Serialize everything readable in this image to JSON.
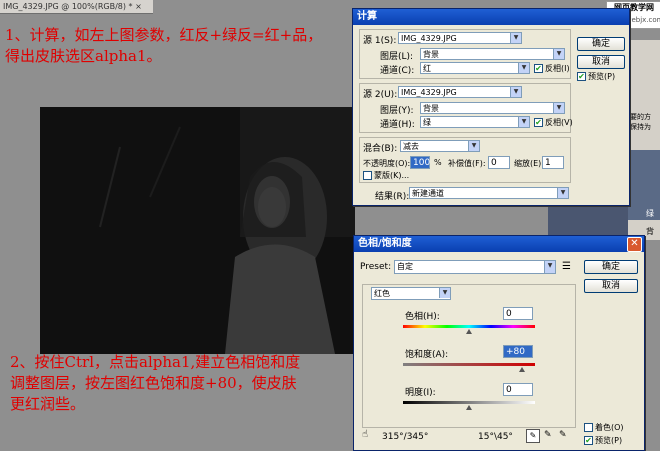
{
  "document_tab": {
    "title": "IMG_4329.JPG @ 100%(RGB/8) *",
    "close": "×"
  },
  "annotation_top": {
    "line1": "1、计算，如左上图参数，红反+绿反=红+品，",
    "line2": "得出皮肤选区alpha1。"
  },
  "annotation_bottom": {
    "line1": "2、按住Ctrl，点击alpha1,建立色相饱和度",
    "line2": "调整图层，按左图红色饱和度+80，使皮肤",
    "line3": "更红润些。"
  },
  "watermark": {
    "site_cn": "网页教学网",
    "site_url": "www.webjx.com"
  },
  "calc_dialog": {
    "title": "计算",
    "source1": {
      "label": "源 1(S):",
      "file": "IMG_4329.JPG",
      "layer_label": "图层(L):",
      "layer": "背景",
      "channel_label": "通道(C):",
      "channel": "红",
      "invert_label": "反相(I)",
      "invert": true
    },
    "source2": {
      "label": "源 2(U):",
      "file": "IMG_4329.JPG",
      "layer_label": "图层(Y):",
      "layer": "背景",
      "channel_label": "通道(H):",
      "channel": "绿",
      "invert_label": "反相(V)",
      "invert": true
    },
    "blending": {
      "label": "混合(B):",
      "mode": "减去",
      "opacity_label": "不透明度(O):",
      "opacity": "100",
      "percent": "%",
      "offset_label": "补偿值(F):",
      "offset": "0",
      "scale_label": "缩放(E):",
      "scale": "1",
      "mask_label": "蒙版(K)..."
    },
    "result": {
      "label": "结果(R):",
      "value": "新建通道"
    },
    "ok": "确定",
    "cancel": "取消",
    "preview_label": "预览(P)",
    "preview": true
  },
  "hue_dialog": {
    "title": "色相/饱和度",
    "preset_label": "Preset:",
    "preset": "自定",
    "channel": "红色",
    "hue_label": "色相(H):",
    "hue": "0",
    "hue_level": 0.5,
    "saturation_label": "饱和度(A):",
    "saturation": "+80",
    "saturation_level": 0.9,
    "lightness_label": "明度(I):",
    "lightness": "0",
    "lightness_level": 0.5,
    "ok": "确定",
    "cancel": "取消",
    "range_left": "315°/345°",
    "range_right": "15°\\45°",
    "colorize_label": "着色(O)",
    "colorize": false,
    "preview_label": "预览(P)",
    "preview": true,
    "colors": {
      "accent": "#316ac5",
      "title_bar": "#0a3fb0"
    }
  },
  "side_panel": {
    "info_line1": "要的方",
    "info_line2": "保持为",
    "layer1": "绿",
    "layer2": "背"
  }
}
